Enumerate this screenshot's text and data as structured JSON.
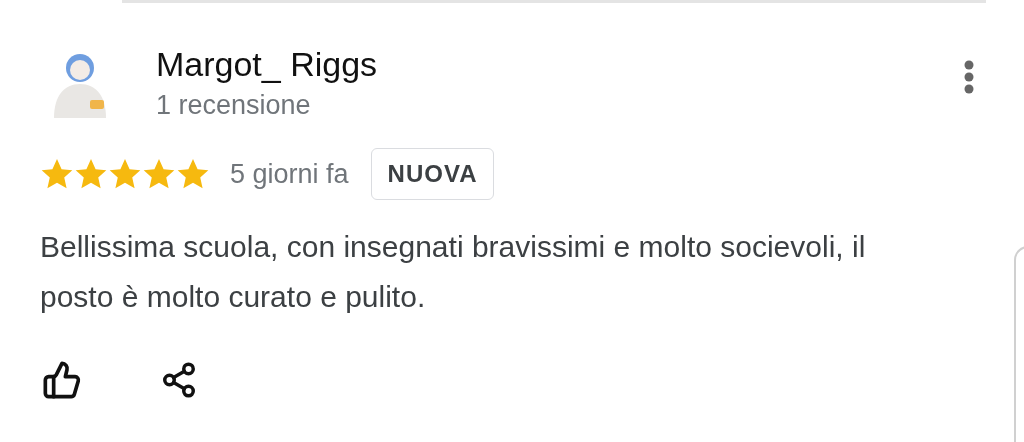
{
  "review": {
    "author": "Margot_ Riggs",
    "author_meta": "1 recensione",
    "stars": 5,
    "time": "5 giorni fa",
    "badge": "NUOVA",
    "text": "Bellissima scuola, con insegnati bravissimi e molto socievoli, il posto è molto curato e pulito."
  }
}
